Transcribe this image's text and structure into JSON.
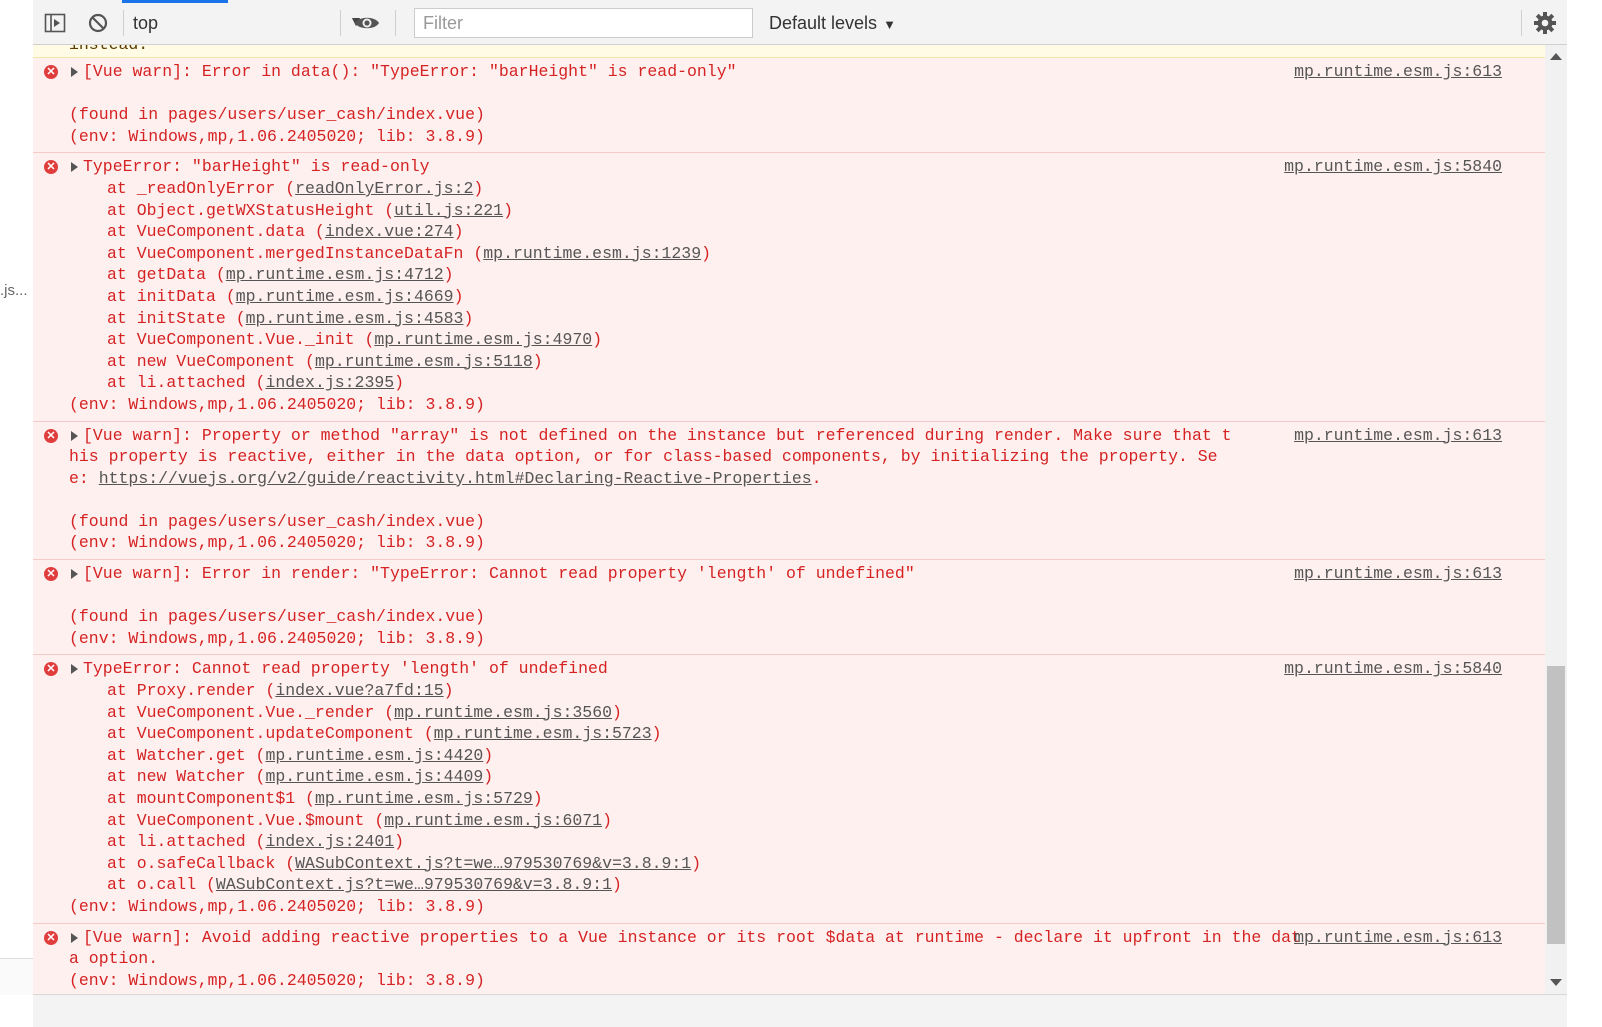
{
  "toolbar": {
    "context": "top",
    "filter_placeholder": "Filter",
    "levels": "Default levels"
  },
  "left_panel": {
    "truncated_text": ".js..."
  },
  "top_warning_tail": "instead.",
  "messages": [
    {
      "source": "mp.runtime.esm.js:613",
      "title": "[Vue warn]: Error in data(): \"TypeError: \"barHeight\" is read-only\"",
      "found": "(found in pages/users/user_cash/index.vue)",
      "env": "(env: Windows,mp,1.06.2405020; lib: 3.8.9)"
    },
    {
      "source": "mp.runtime.esm.js:5840",
      "title": "TypeError: \"barHeight\" is read-only",
      "stack": [
        {
          "fn": "at _readOnlyError (",
          "loc": "readOnlyError.js:2",
          "end": ")"
        },
        {
          "fn": "at Object.getWXStatusHeight (",
          "loc": "util.js:221",
          "end": ")"
        },
        {
          "fn": "at VueComponent.data (",
          "loc": "index.vue:274",
          "end": ")"
        },
        {
          "fn": "at VueComponent.mergedInstanceDataFn (",
          "loc": "mp.runtime.esm.js:1239",
          "end": ")"
        },
        {
          "fn": "at getData (",
          "loc": "mp.runtime.esm.js:4712",
          "end": ")"
        },
        {
          "fn": "at initData (",
          "loc": "mp.runtime.esm.js:4669",
          "end": ")"
        },
        {
          "fn": "at initState (",
          "loc": "mp.runtime.esm.js:4583",
          "end": ")"
        },
        {
          "fn": "at VueComponent.Vue._init (",
          "loc": "mp.runtime.esm.js:4970",
          "end": ")"
        },
        {
          "fn": "at new VueComponent (",
          "loc": "mp.runtime.esm.js:5118",
          "end": ")"
        },
        {
          "fn": "at li.attached (",
          "loc": "index.js:2395",
          "end": ")"
        }
      ],
      "env": "(env: Windows,mp,1.06.2405020; lib: 3.8.9)"
    },
    {
      "source": "mp.runtime.esm.js:613",
      "title": "[Vue warn]: Property or method \"array\" is not defined on the instance but referenced during render. Make sure that this property is reactive, either in the data option, or for class-based components, by initializing the property. See: ",
      "link": "https://vuejs.org/v2/guide/reactivity.html#Declaring-Reactive-Properties",
      "title_end": ".",
      "found": "(found in pages/users/user_cash/index.vue)",
      "env": "(env: Windows,mp,1.06.2405020; lib: 3.8.9)"
    },
    {
      "source": "mp.runtime.esm.js:613",
      "title": "[Vue warn]: Error in render: \"TypeError: Cannot read property 'length' of undefined\"",
      "found": "(found in pages/users/user_cash/index.vue)",
      "env": "(env: Windows,mp,1.06.2405020; lib: 3.8.9)"
    },
    {
      "source": "mp.runtime.esm.js:5840",
      "title": "TypeError: Cannot read property 'length' of undefined",
      "stack": [
        {
          "fn": "at Proxy.render (",
          "loc": "index.vue?a7fd:15",
          "end": ")"
        },
        {
          "fn": "at VueComponent.Vue._render (",
          "loc": "mp.runtime.esm.js:3560",
          "end": ")"
        },
        {
          "fn": "at VueComponent.updateComponent (",
          "loc": "mp.runtime.esm.js:5723",
          "end": ")"
        },
        {
          "fn": "at Watcher.get (",
          "loc": "mp.runtime.esm.js:4420",
          "end": ")"
        },
        {
          "fn": "at new Watcher (",
          "loc": "mp.runtime.esm.js:4409",
          "end": ")"
        },
        {
          "fn": "at mountComponent$1 (",
          "loc": "mp.runtime.esm.js:5729",
          "end": ")"
        },
        {
          "fn": "at VueComponent.Vue.$mount (",
          "loc": "mp.runtime.esm.js:6071",
          "end": ")"
        },
        {
          "fn": "at li.attached (",
          "loc": "index.js:2401",
          "end": ")"
        },
        {
          "fn": "at o.safeCallback (",
          "loc": "WASubContext.js?t=we…979530769&v=3.8.9:1",
          "end": ")"
        },
        {
          "fn": "at o.call (",
          "loc": "WASubContext.js?t=we…979530769&v=3.8.9:1",
          "end": ")"
        }
      ],
      "env": "(env: Windows,mp,1.06.2405020; lib: 3.8.9)"
    },
    {
      "source": "mp.runtime.esm.js:613",
      "title": "[Vue warn]: Avoid adding reactive properties to a Vue instance or its root $data at runtime - declare it upfront in the data option.",
      "env": "(env: Windows,mp,1.06.2405020; lib: 3.8.9)"
    }
  ]
}
